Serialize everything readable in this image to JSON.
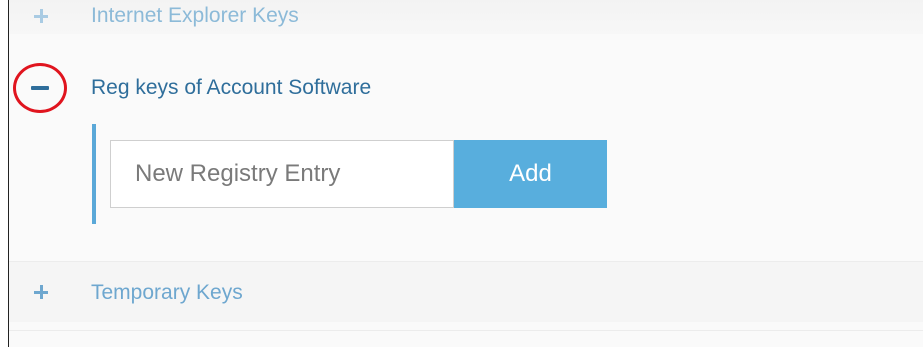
{
  "tree": {
    "items": [
      {
        "label": "Internet Explorer Keys",
        "state": "collapsed"
      },
      {
        "label": "Reg keys of Account Software",
        "state": "expanded"
      },
      {
        "label": "Temporary Keys",
        "state": "collapsed"
      }
    ]
  },
  "entry": {
    "placeholder": "New Registry Entry",
    "add_label": "Add"
  },
  "colors": {
    "accent": "#58aedd",
    "highlight_circle": "#e0141e",
    "link": "#2f6e9b"
  },
  "icons": {
    "expand": "plus-icon",
    "collapse": "minus-icon"
  }
}
